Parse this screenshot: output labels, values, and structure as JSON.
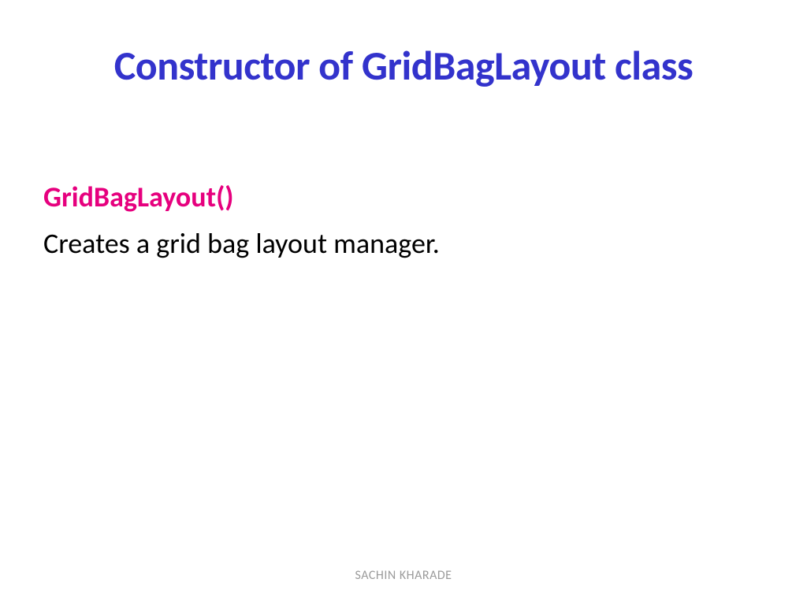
{
  "slide": {
    "title": "Constructor of GridBagLayout class",
    "constructor": {
      "name": "GridBagLayout()",
      "description": "Creates a grid bag layout manager."
    },
    "footer": {
      "author": "SACHIN KHARADE"
    }
  }
}
